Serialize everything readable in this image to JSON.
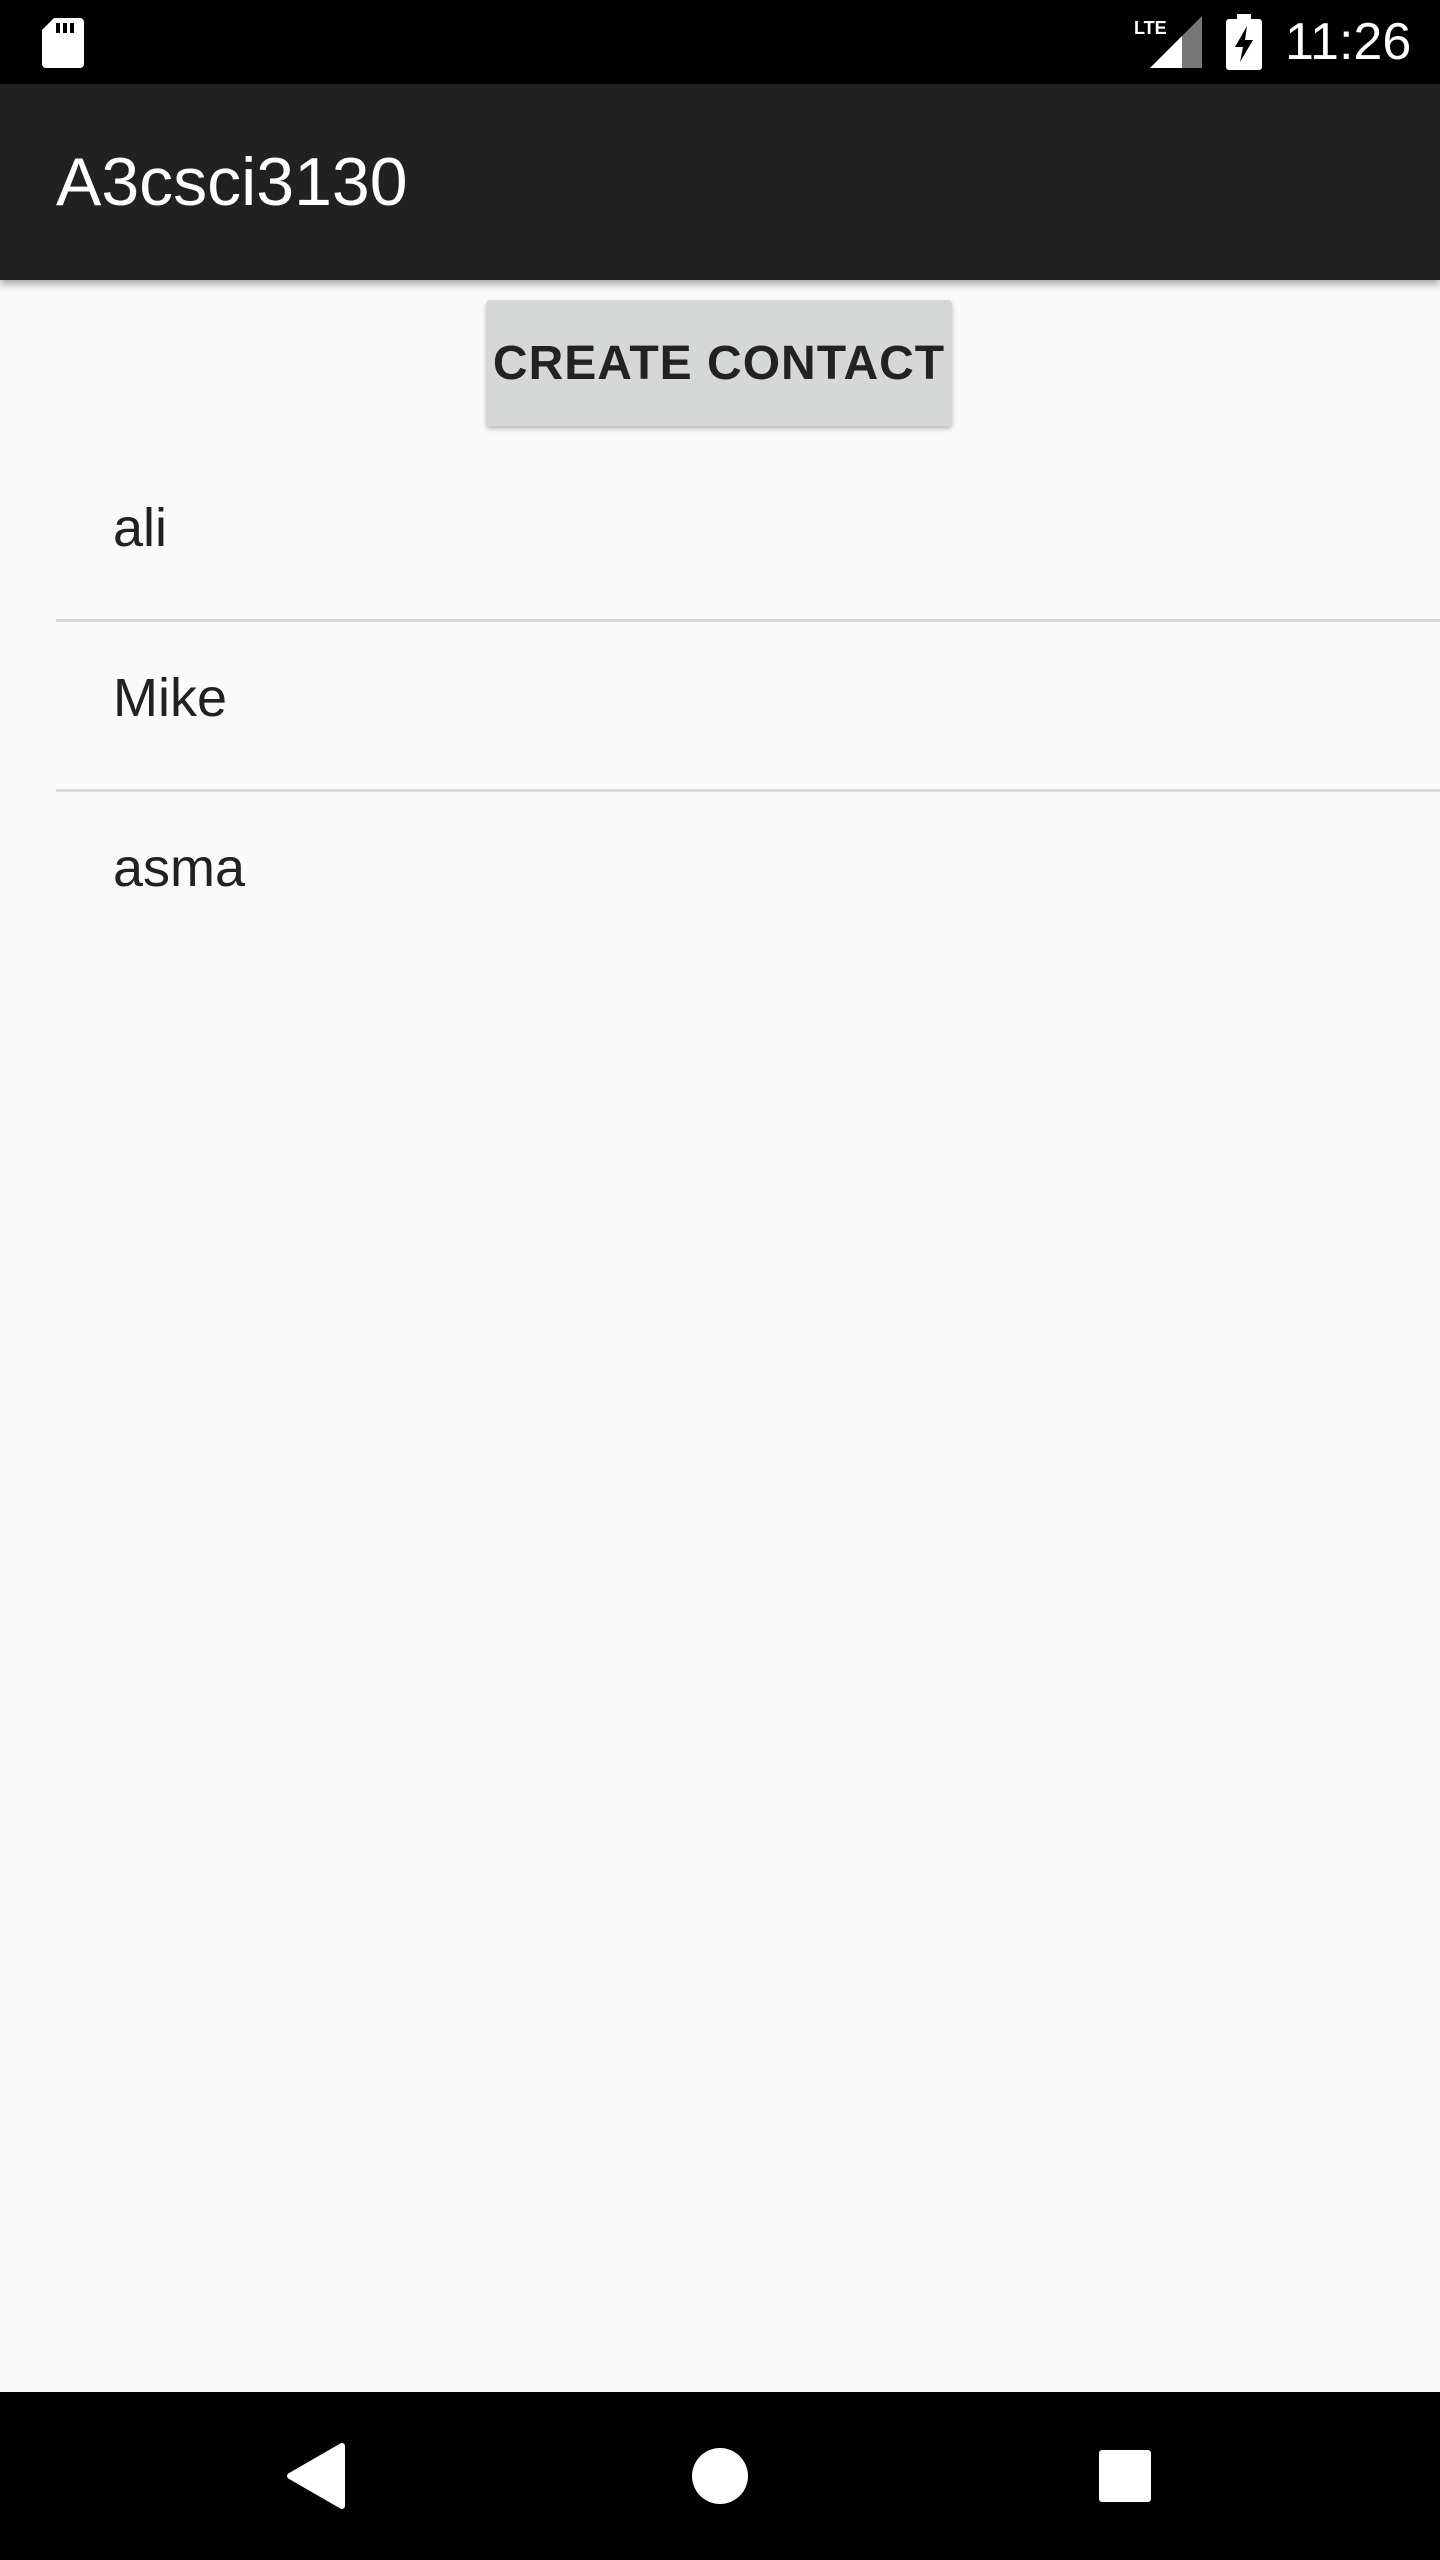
{
  "status_bar": {
    "time": "11:26",
    "network": "LTE",
    "icons": [
      "sd-card-icon",
      "lte-signal-icon",
      "battery-charging-icon"
    ]
  },
  "app_bar": {
    "title": "A3csci3130"
  },
  "actions": {
    "create_contact_label": "CREATE CONTACT"
  },
  "contacts": [
    {
      "name": "ali"
    },
    {
      "name": "Mike"
    },
    {
      "name": "asma"
    }
  ],
  "nav_bar": {
    "icons": [
      "back-icon",
      "home-icon",
      "recents-icon"
    ]
  },
  "colors": {
    "status_bar": "#000000",
    "app_bar": "#212121",
    "background": "#fafafa",
    "button": "#d6d7d7",
    "divider": "#d9d9d9",
    "text": "#212121"
  }
}
